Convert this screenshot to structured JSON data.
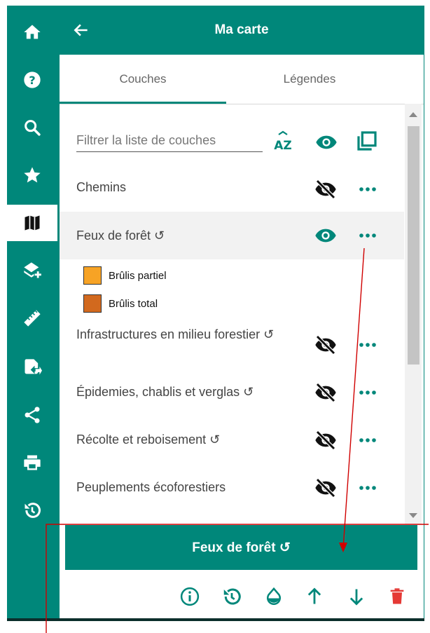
{
  "app": {
    "title": "Ma carte"
  },
  "tabs": [
    {
      "label": "Couches"
    },
    {
      "label": "Légendes"
    }
  ],
  "filter": {
    "placeholder": "Filtrer la liste de couches",
    "sort_label": "AZ"
  },
  "layers": [
    {
      "label": "Chemins",
      "visible": false
    },
    {
      "label": "Feux de forêt ↺",
      "visible": true,
      "selected": true
    },
    {
      "label": "Infrastructures en milieu forestier ↺",
      "visible": false
    },
    {
      "label": "Épidemies, chablis et verglas ↺",
      "visible": false
    },
    {
      "label": "Récolte et reboisement ↺",
      "visible": false
    },
    {
      "label": "Peuplements écoforestiers",
      "visible": false
    }
  ],
  "legend": [
    {
      "label": "Brûlis partiel",
      "color": "#f7a325"
    },
    {
      "label": "Brûlis total",
      "color": "#d2691e"
    }
  ],
  "selected_layer": {
    "label": "Feux de forêt ↺"
  },
  "sidebar": {
    "items": [
      {
        "icon": "home-icon"
      },
      {
        "icon": "help-icon"
      },
      {
        "icon": "search-icon"
      },
      {
        "icon": "star-icon"
      },
      {
        "icon": "map-icon",
        "active": true
      },
      {
        "icon": "add-layer-icon"
      },
      {
        "icon": "ruler-icon"
      },
      {
        "icon": "file-export-icon"
      },
      {
        "icon": "share-icon"
      },
      {
        "icon": "print-icon"
      },
      {
        "icon": "history-icon"
      }
    ]
  },
  "colors": {
    "primary": "#00877a",
    "danger": "#e53935",
    "dark": "#111111"
  }
}
